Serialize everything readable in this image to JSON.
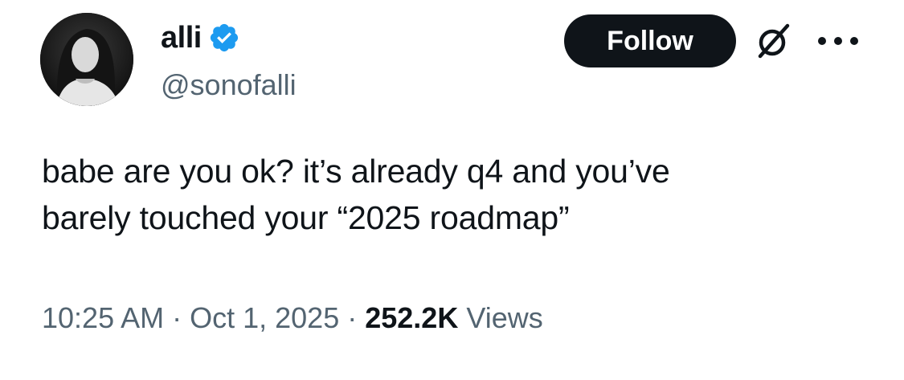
{
  "author": {
    "display_name": "alli",
    "handle": "@sonofalli",
    "verified": true,
    "verified_color": "#1d9bf0",
    "avatar": "avatar-photo"
  },
  "actions": {
    "follow_label": "Follow",
    "grok_icon": "grok-icon",
    "more_icon": "more-options-icon"
  },
  "tweet": {
    "lines": [
      "babe are you ok? it’s already q4 and you’ve",
      "barely touched your “2025 roadmap”"
    ]
  },
  "meta": {
    "time": "10:25 AM",
    "separator": "·",
    "date": "Oct 1, 2025",
    "views_count": "252.2K",
    "views_label": "Views"
  },
  "colors": {
    "text": "#0f1419",
    "secondary": "#536471",
    "button_bg": "#0f1419",
    "button_text": "#ffffff"
  }
}
